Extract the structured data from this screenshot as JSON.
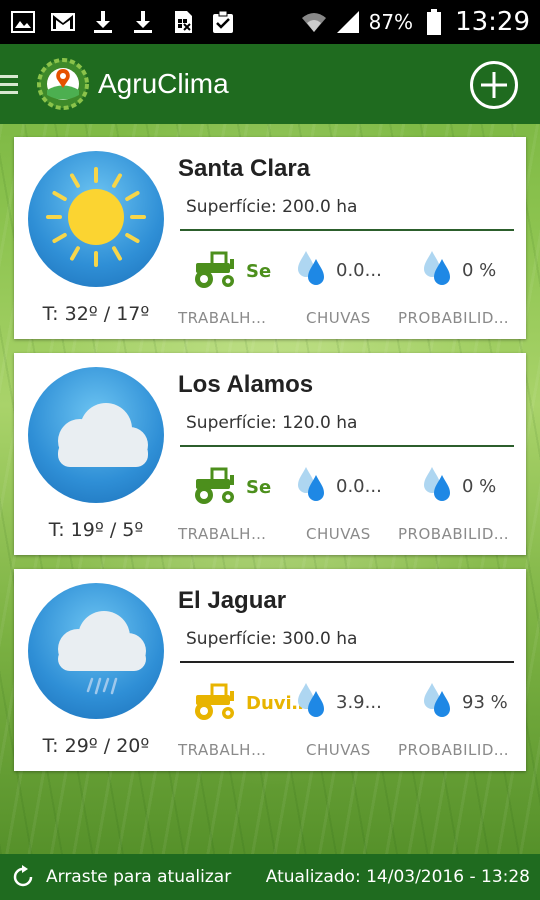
{
  "status_bar": {
    "battery": "87%",
    "time": "13:29",
    "icons": [
      "image-icon",
      "gmail-icon",
      "download-icon",
      "download-icon",
      "sim-icon",
      "clipboard-icon",
      "wifi-icon",
      "signal-icon",
      "battery-icon"
    ]
  },
  "app": {
    "title": "AgruClima",
    "add_icon": "add-circle-icon",
    "menu_icon": "menu-icon"
  },
  "farms": [
    {
      "name": "Santa Clara",
      "surface": "Superfície: 200.0 ha",
      "temps": "T: 32º / 17º",
      "weather_icon": "sun-icon",
      "work_value": "Se",
      "work_label": "TRABALHÁVEL",
      "work_color": "#4c8f1c",
      "rain_value": "0.0...",
      "rain_label": "CHUVAS",
      "prob_value": "0 %",
      "prob_label": "PROBABILIDADE"
    },
    {
      "name": "Los Alamos",
      "surface": "Superfície: 120.0 ha",
      "temps": "T: 19º / 5º",
      "weather_icon": "cloud-icon",
      "work_value": "Se",
      "work_label": "TRABALHÁVEL",
      "work_color": "#4c8f1c",
      "rain_value": "0.0...",
      "rain_label": "CHUVAS",
      "prob_value": "0 %",
      "prob_label": "PROBABILIDADE"
    },
    {
      "name": "El Jaguar",
      "surface": "Superfície: 300.0 ha",
      "temps": "T: 29º / 20º",
      "weather_icon": "rain-cloud-icon",
      "work_value": "Duvid...",
      "work_label": "TRABALHÁVEL",
      "work_color": "#e8b400",
      "rain_value": "3.9...",
      "rain_label": "CHUVAS",
      "prob_value": "93 %",
      "prob_label": "PROBABILIDADE"
    }
  ],
  "footer": {
    "pull_to_refresh": "Arraste para atualizar",
    "updated": "Atualizado: 14/03/2016 - 13:28"
  }
}
